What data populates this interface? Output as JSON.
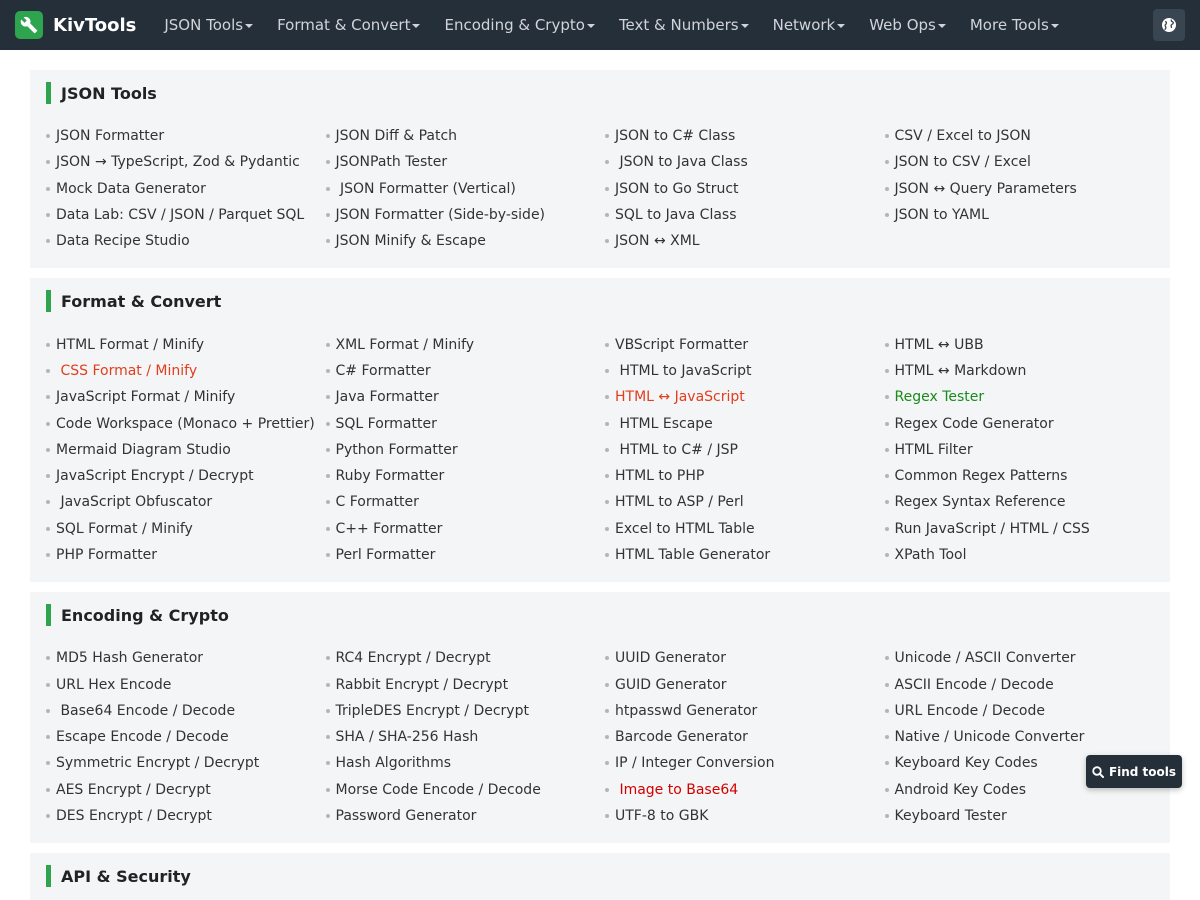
{
  "brand": {
    "name": "KivTools"
  },
  "nav": [
    {
      "label": "JSON Tools"
    },
    {
      "label": "Format & Convert"
    },
    {
      "label": "Encoding & Crypto"
    },
    {
      "label": "Text & Numbers"
    },
    {
      "label": "Network"
    },
    {
      "label": "Web Ops"
    },
    {
      "label": "More Tools"
    }
  ],
  "icons": {
    "logo": "wrench-icon",
    "language": "globe-icon",
    "find": "search-icon"
  },
  "colors": {
    "navbar": "#252f3a",
    "accent": "#2ea44f",
    "hot_orange": "#e03e1e",
    "hot_red": "#d40000",
    "green_link": "#1a8a1a",
    "section_bg": "#f4f5f6"
  },
  "sections": [
    {
      "title": "JSON Tools",
      "rows": 5,
      "tools": [
        {
          "label": "JSON Formatter"
        },
        {
          "label": "JSON → TypeScript, Zod & Pydantic"
        },
        {
          "label": "Mock Data Generator"
        },
        {
          "label": "Data Lab: CSV / JSON / Parquet SQL"
        },
        {
          "label": "Data Recipe Studio"
        },
        {
          "label": "JSON Diff & Patch"
        },
        {
          "label": "JSONPath Tester"
        },
        {
          "label": " JSON Formatter (Vertical)"
        },
        {
          "label": "JSON Formatter (Side-by-side)"
        },
        {
          "label": "JSON Minify & Escape"
        },
        {
          "label": "JSON to C# Class"
        },
        {
          "label": " JSON to Java Class"
        },
        {
          "label": "JSON to Go Struct"
        },
        {
          "label": "SQL to Java Class"
        },
        {
          "label": "JSON ↔ XML"
        },
        {
          "label": "CSV / Excel to JSON"
        },
        {
          "label": "JSON to CSV / Excel"
        },
        {
          "label": "JSON ↔ Query Parameters"
        },
        {
          "label": "JSON to YAML"
        }
      ]
    },
    {
      "title": "Format & Convert",
      "rows": 9,
      "tools": [
        {
          "label": "HTML Format / Minify"
        },
        {
          "label": " CSS Format / Minify",
          "style": "hot"
        },
        {
          "label": "JavaScript Format / Minify"
        },
        {
          "label": "Code Workspace (Monaco + Prettier)"
        },
        {
          "label": "Mermaid Diagram Studio"
        },
        {
          "label": "JavaScript Encrypt / Decrypt"
        },
        {
          "label": " JavaScript Obfuscator"
        },
        {
          "label": "SQL Format / Minify"
        },
        {
          "label": "PHP Formatter"
        },
        {
          "label": "XML Format / Minify"
        },
        {
          "label": "C# Formatter"
        },
        {
          "label": "Java Formatter"
        },
        {
          "label": "SQL Formatter"
        },
        {
          "label": "Python Formatter"
        },
        {
          "label": "Ruby Formatter"
        },
        {
          "label": "C Formatter"
        },
        {
          "label": "C++ Formatter"
        },
        {
          "label": "Perl Formatter"
        },
        {
          "label": "VBScript Formatter"
        },
        {
          "label": " HTML to JavaScript"
        },
        {
          "label": "HTML ↔ JavaScript",
          "style": "hot"
        },
        {
          "label": " HTML Escape"
        },
        {
          "label": " HTML to C# / JSP"
        },
        {
          "label": "HTML to PHP"
        },
        {
          "label": "HTML to ASP / Perl"
        },
        {
          "label": "Excel to HTML Table"
        },
        {
          "label": "HTML Table Generator"
        },
        {
          "label": "HTML ↔ UBB"
        },
        {
          "label": "HTML ↔ Markdown"
        },
        {
          "label": "Regex Tester",
          "style": "green"
        },
        {
          "label": "Regex Code Generator"
        },
        {
          "label": "HTML Filter"
        },
        {
          "label": "Common Regex Patterns"
        },
        {
          "label": "Regex Syntax Reference"
        },
        {
          "label": "Run JavaScript / HTML / CSS"
        },
        {
          "label": "XPath Tool"
        }
      ]
    },
    {
      "title": "Encoding & Crypto",
      "rows": 7,
      "tools": [
        {
          "label": "MD5 Hash Generator"
        },
        {
          "label": "URL Hex Encode"
        },
        {
          "label": " Base64 Encode / Decode"
        },
        {
          "label": "Escape Encode / Decode"
        },
        {
          "label": "Symmetric Encrypt / Decrypt"
        },
        {
          "label": "AES Encrypt / Decrypt"
        },
        {
          "label": "DES Encrypt / Decrypt"
        },
        {
          "label": "RC4 Encrypt / Decrypt"
        },
        {
          "label": "Rabbit Encrypt / Decrypt"
        },
        {
          "label": "TripleDES Encrypt / Decrypt"
        },
        {
          "label": "SHA / SHA-256 Hash"
        },
        {
          "label": "Hash Algorithms"
        },
        {
          "label": "Morse Code Encode / Decode"
        },
        {
          "label": "Password Generator"
        },
        {
          "label": "UUID Generator"
        },
        {
          "label": "GUID Generator"
        },
        {
          "label": "htpasswd Generator"
        },
        {
          "label": "Barcode Generator"
        },
        {
          "label": "IP / Integer Conversion"
        },
        {
          "label": " Image to Base64",
          "style": "red"
        },
        {
          "label": "UTF-8 to GBK"
        },
        {
          "label": "Unicode / ASCII Converter"
        },
        {
          "label": "ASCII Encode / Decode"
        },
        {
          "label": "URL Encode / Decode"
        },
        {
          "label": "Native / Unicode Converter"
        },
        {
          "label": "Keyboard Key Codes"
        },
        {
          "label": "Android Key Codes"
        },
        {
          "label": "Keyboard Tester"
        }
      ]
    },
    {
      "title": "API & Security",
      "rows": 0,
      "tools": []
    }
  ],
  "find_tools": {
    "label": "Find tools"
  }
}
